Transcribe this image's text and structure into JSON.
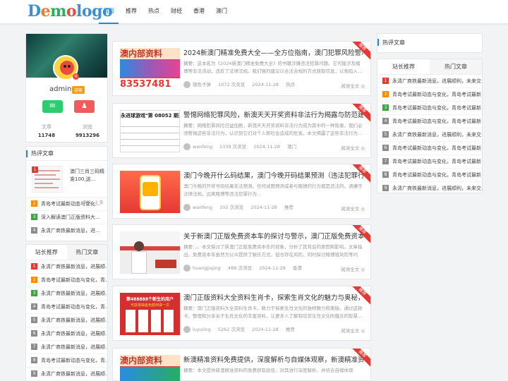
{
  "site": {
    "logo": "Demologo",
    "accent": "#1e88e5"
  },
  "nav": [
    "首页",
    "推荐",
    "热点",
    "财经",
    "香港",
    "澳门"
  ],
  "profile": {
    "name": "admin",
    "tag": "游客",
    "stats": [
      {
        "label": "文章",
        "value": "11748"
      },
      {
        "label": "浏览",
        "value": "9913296"
      }
    ]
  },
  "hot": {
    "title": "热评文章",
    "top": {
      "title": "澳门三肖三码精准100,送…",
      "comments": "评论：2 条"
    },
    "items": [
      "青岛考试最新动态与变化…",
      "深入解读澳门正版资料大…",
      "永清广商铁最新消息，进…"
    ]
  },
  "left_tabs": {
    "tabs": [
      "站长推荐",
      "热门文章"
    ],
    "items": [
      "永清广商铁最新消息，进展顺…",
      "青岛考试最新动态与变化，青…",
      "永清广商铁最新消息，进展顺…",
      "青岛考试最新动态与变化，青…",
      "永清广商铁最新消息，进展顺…",
      "永清广商铁最新消息，进展顺…",
      "永清广商铁最新消息，进展顺…",
      "青岛考试最新动态与变化，青…",
      "永清广商铁最新消息，进展顺…"
    ]
  },
  "right": {
    "title": "热评文章",
    "tabs": [
      "站长推荐",
      "热门文章"
    ],
    "items": [
      "永清广商铁最新消息，进展顺利，未来交…",
      "青岛考试最新动态与变化，青岛考试最新…",
      "青岛考试最新动态与变化，青岛考试最新…",
      "青岛考试最新动态与变化，青岛考试最新…",
      "永清广商铁最新消息，进展顺利，未来交…",
      "青岛考试最新动态与变化，青岛考试最新…",
      "青岛考试最新动态与变化，青岛考试最新…",
      "青岛考试最新动态与变化，青岛考试最新…",
      "永清广商铁最新消息，进展顺利，未来交…"
    ]
  },
  "ribbon": "推荐",
  "read_more": "阅读全文 ◎",
  "articles": [
    {
      "title": "2024新澳门精准免费大全——全方位指南，澳门犯罪风险警示…",
      "summary": "摘要：这本名为《2024新澳门精准免费大全》的书籍涉嫌违法犯罪问题。它可能涉及赌博等非法活动，违反了法律法规。我们强烈建议以合法合规的方式获取信息，以免陷入…",
      "author": "银色子弹",
      "views": "1072 次浏览",
      "date": "2024-11-28",
      "cat": "热点",
      "thumb_text": "澳内部资料",
      "thumb_num": "83537481"
    },
    {
      "title": "警惕网络犯罪风险，新澳天天开奖资料非法行为揭露与防范建…",
      "summary": "摘要：网络犯罪风险日益加剧，新澳天天开奖资料非法行为成为其中的一种隐患。我们必须警惕这些非法行为，认识到它们对个人和社会造成的危害。本文揭露了这些非法行为…",
      "author": "wanfeng",
      "views": "2339 次浏览",
      "date": "2024-11-28",
      "cat": "澳门",
      "thumb_text": "永进球游戏\"第 08052 期开奖"
    },
    {
      "title": "澳门今晚开什么码结果，澳门今晚开码结果预测（违法犯罪行…",
      "summary": "澳门今晚的开奖号码结果未法预测。任何试图预测或参与赌博的行为都是违法的。请遵守法律法规，远离赌博等违法犯罪行为…",
      "author": "wanfeng",
      "views": "102 次浏览",
      "date": "2024-11-28",
      "cat": "推荐"
    },
    {
      "title": "关于新澳门正版免费资本车的探讨与警示，澳门正版免费资本…",
      "summary": "摘要：，。本文探讨了新澳门正版免费资本车的现象，分析了其背后的原因和影响。文章指出，免费资本车虽然为公众提供了娱乐方式，但也存在风险。同时探讨赌博感风险等问题…",
      "author": "huangjiajing",
      "views": "488 次浏览",
      "date": "2024-11-28",
      "cat": "香港"
    },
    {
      "title": "澳门正版资料大全资料生肖卡，探索生肖文化的魅力与奥秘，…",
      "summary": "摘要：澳门正版资料大全资料生肖卡，致力于探索生肖文化的独特魅力和奥秘。通过这款卡，整理和分享关于生肖文化的丰富资料，让更多人了解和欣赏生肖文化所蕴含的智慧…",
      "author": "luyuling",
      "views": "5262 次浏览",
      "date": "2024-11-28",
      "cat": "推荐",
      "thumb_text": "第488888个新生的用户",
      "thumb_sub": "可获得抽金色额到得一次"
    },
    {
      "title": "新澳精准资料免费提供，深度解析与自媒体观察，新澳精准资…",
      "summary": "摘要：本文提供新澳精准资料的免费获取途径，对其进行深度解析，并结合自媒体观察。…",
      "author": "",
      "views": "",
      "date": "",
      "cat": "",
      "thumb_text": "澳内部资料"
    }
  ]
}
